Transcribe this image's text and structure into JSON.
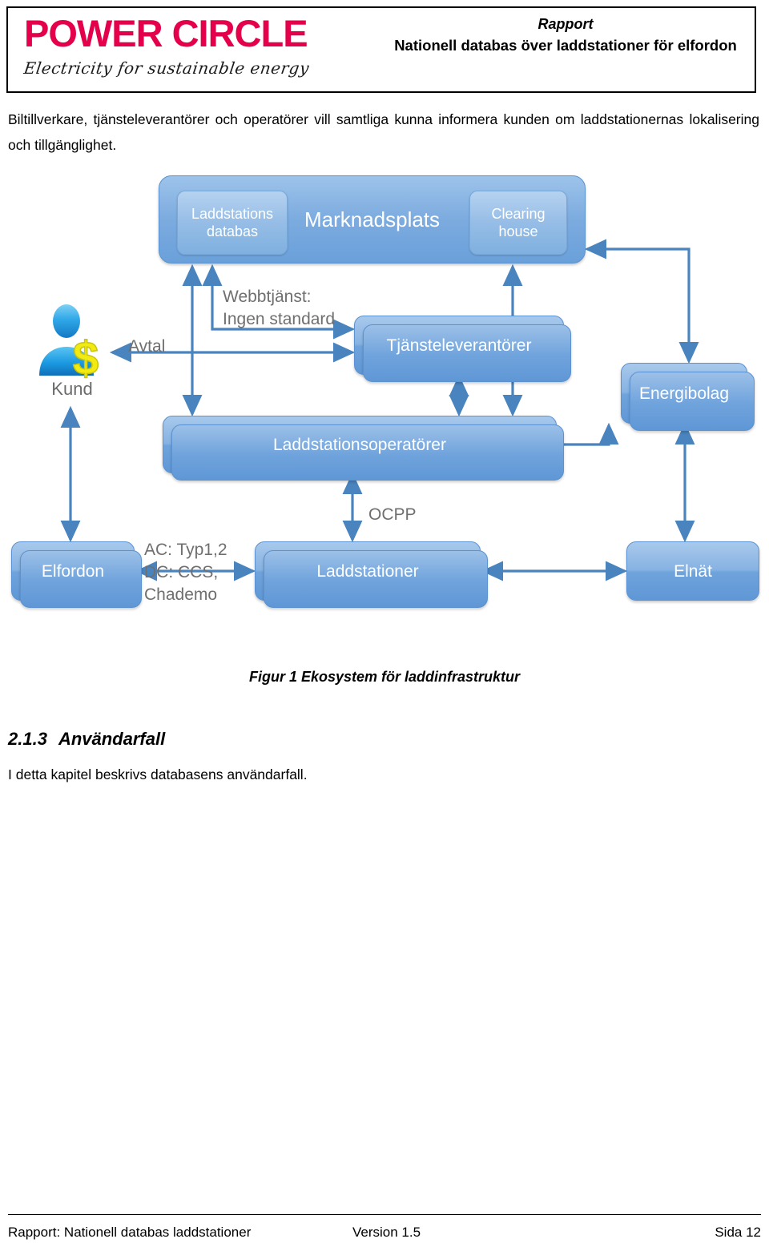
{
  "header": {
    "logo_wordmark": "POWER CIRCLE",
    "logo_tagline": "Electricity for sustainable energy",
    "logo_color": "#E4004B",
    "kicker": "Rapport",
    "title": "Nationell databas över laddstationer för elfordon"
  },
  "body": {
    "intro_paragraph": "Biltillverkare, tjänsteleverantörer och operatörer vill samtliga kunna informera kunden om laddstationernas lokalisering och tillgänglighet.",
    "figure_caption": "Figur 1 Ekosystem för laddinfrastruktur",
    "section_number": "2.1.3",
    "section_title": "Användarfall",
    "section_paragraph": "I detta kapitel beskrivs databasens användarfall."
  },
  "figure": {
    "accent_color": "#6fa3dc",
    "edge_color": "#4a84bf",
    "label_color": "#6f6f6f",
    "nodes": {
      "marknadsplats": "Marknadsplats",
      "laddstations_databas": "Laddstations\ndatabas",
      "clearing_house": "Clearing\nhouse",
      "tjansteleverantorer": "Tjänsteleverantörer",
      "laddstationsoperatorer": "Laddstationsoperatörer",
      "energibolag": "Energibolag",
      "elfordon": "Elfordon",
      "laddstationer": "Laddstationer",
      "elnat": "Elnät",
      "kund": "Kund"
    },
    "edge_labels": {
      "avtal": "Avtal",
      "webbtjanst": "Webbtjänst:\nIngen standard",
      "ocpp": "OCPP",
      "connectors": "AC: Typ1,2\nDC: CCS,\nChademo"
    }
  },
  "footer": {
    "left": "Rapport: Nationell databas laddstationer",
    "center": "Version 1.5",
    "right": "Sida 12"
  }
}
